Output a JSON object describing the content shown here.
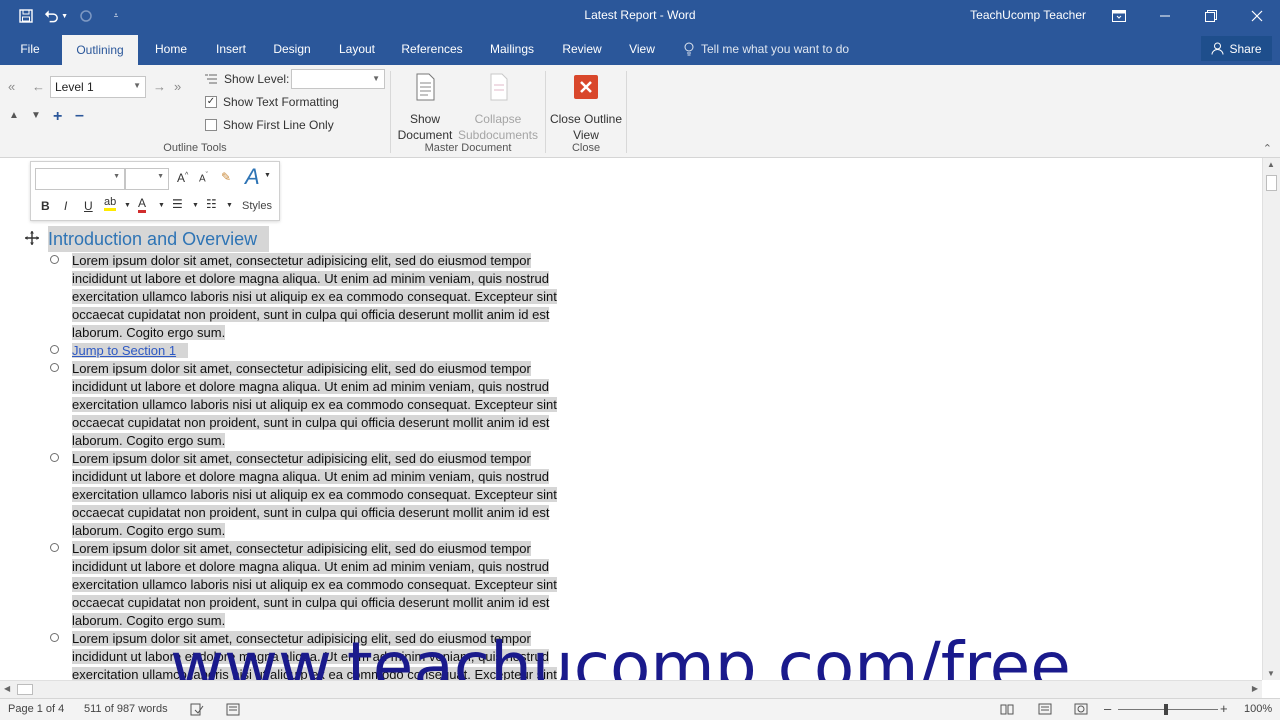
{
  "title_bar": {
    "doc_title": "Latest Report - Word",
    "user": "TeachUcomp Teacher"
  },
  "tabs": [
    {
      "label": "File",
      "active": false
    },
    {
      "label": "Outlining",
      "active": true
    },
    {
      "label": "Home",
      "active": false
    },
    {
      "label": "Insert",
      "active": false
    },
    {
      "label": "Design",
      "active": false
    },
    {
      "label": "Layout",
      "active": false
    },
    {
      "label": "References",
      "active": false
    },
    {
      "label": "Mailings",
      "active": false
    },
    {
      "label": "Review",
      "active": false
    },
    {
      "label": "View",
      "active": false
    }
  ],
  "tell_me": "Tell me what you want to do",
  "share": "Share",
  "ribbon": {
    "outline_level": "Level 1",
    "show_level_label": "Show Level:",
    "show_level_value": "",
    "show_text_formatting": "Show Text Formatting",
    "show_text_formatting_checked": true,
    "show_first_line_only": "Show First Line Only",
    "show_first_line_only_checked": false,
    "outline_tools_label": "Outline Tools",
    "show_document": "Show Document",
    "collapse_subdocuments": "Collapse Subdocuments",
    "master_document_label": "Master Document",
    "close_outline_view": "Close Outline View",
    "close_label": "Close"
  },
  "mini_toolbar": {
    "styles_label": "Styles"
  },
  "document": {
    "heading": "Introduction and Overview",
    "link_text": "Jump to Section 1",
    "lorem_lines": [
      "Lorem ipsum dolor sit amet, consectetur adipisicing elit, sed do eiusmod tempor",
      "incididunt ut labore et dolore magna aliqua. Ut enim ad minim veniam, quis nostrud",
      "exercitation ullamco laboris nisi ut aliquip ex ea commodo consequat. Excepteur sint",
      "occaecat cupidatat non proident, sunt in culpa qui officia deserunt mollit anim id est",
      "laborum. Cogito ergo sum."
    ]
  },
  "watermark": "www.teachucomp.com/free",
  "status_bar": {
    "page": "Page 1 of 4",
    "words": "511 of 987 words",
    "zoom": "100%"
  },
  "colors": {
    "brand": "#2b579a",
    "heading": "#2e74b5",
    "selection": "#d6d6d6",
    "close_red": "#d9472b"
  }
}
